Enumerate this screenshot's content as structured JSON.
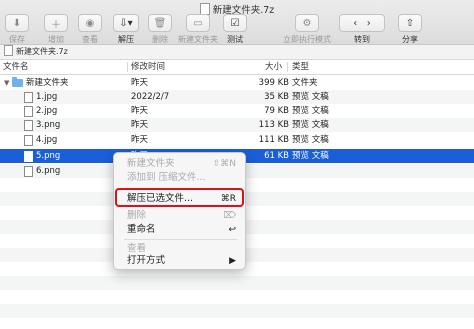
{
  "window": {
    "title": "新建文件夹.7z"
  },
  "toolbar": {
    "buttons": [
      {
        "icon": "save-icon",
        "label": "保存"
      },
      {
        "icon": "add-icon",
        "label": "增加"
      },
      {
        "icon": "eye-icon",
        "label": "查看"
      },
      {
        "icon": "extract-icon",
        "label": "解压"
      },
      {
        "icon": "trash-icon",
        "label": "删除"
      },
      {
        "icon": "new-folder-icon",
        "label": "新建文件夹"
      },
      {
        "icon": "test-icon",
        "label": "测试"
      },
      {
        "icon": "run-icon",
        "label": "立即执行模式"
      },
      {
        "icon": "nav-icon",
        "label": "转到"
      },
      {
        "icon": "share-icon",
        "label": "分享"
      }
    ]
  },
  "pathbar": {
    "text": "新建文件夹.7z"
  },
  "columns": {
    "name": "文件名",
    "modified": "修改时间",
    "size": "大小",
    "kind": "类型"
  },
  "rows": [
    {
      "name": "新建文件夹",
      "modified": "昨天",
      "size": "399 KB",
      "kind": "文件夹"
    },
    {
      "name": "1.jpg",
      "modified": "2022/2/7",
      "size": "35 KB",
      "kind": "预览 文稿"
    },
    {
      "name": "2.jpg",
      "modified": "昨天",
      "size": "79 KB",
      "kind": "预览 文稿"
    },
    {
      "name": "3.png",
      "modified": "昨天",
      "size": "113 KB",
      "kind": "预览 文稿"
    },
    {
      "name": "4.jpg",
      "modified": "昨天",
      "size": "111 KB",
      "kind": "预览 文稿"
    },
    {
      "name": "5.png",
      "modified": "昨天",
      "size": "61 KB",
      "kind": "预览 文稿"
    },
    {
      "name": "6.png",
      "modified": "",
      "size": "",
      "kind": ""
    }
  ],
  "context_menu": {
    "items": [
      {
        "label": "新建文件夹",
        "shortcut": "⇧⌘N",
        "enabled": false
      },
      {
        "label": "添加到 压缩文件...",
        "shortcut": "",
        "enabled": false
      },
      {
        "label": "解压已选文件...",
        "shortcut": "⌘R",
        "enabled": true
      },
      {
        "label": "删除",
        "shortcut": "⌦",
        "enabled": false
      },
      {
        "label": "重命名",
        "shortcut": "↩",
        "enabled": true
      },
      {
        "label": "查看",
        "shortcut": "",
        "enabled": false
      },
      {
        "label": "打开方式",
        "shortcut": "▶",
        "enabled": true
      }
    ]
  },
  "colors": {
    "selection": "#1a5fd8",
    "highlight_box": "#e0101a",
    "folder": "#6cb3ef"
  }
}
